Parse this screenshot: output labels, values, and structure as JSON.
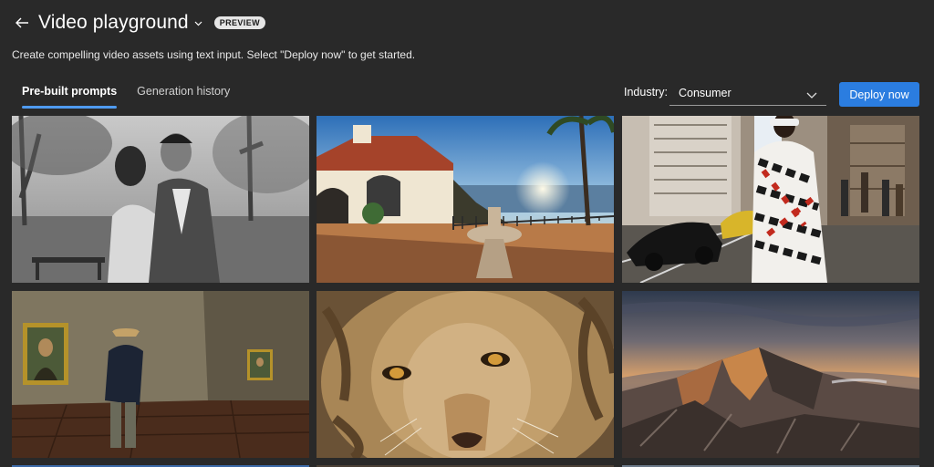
{
  "header": {
    "title": "Video playground",
    "badge": "PREVIEW"
  },
  "subtitle": "Create compelling video assets using text input. Select \"Deploy now\" to get started.",
  "tabs": [
    {
      "label": "Pre-built prompts",
      "active": true
    },
    {
      "label": "Generation history",
      "active": false
    }
  ],
  "filter": {
    "label": "Industry:",
    "selected": "Consumer"
  },
  "deploy_label": "Deploy now",
  "colors": {
    "background": "#292929",
    "accent": "#2b7de0",
    "tab_underline": "#4f9bf0"
  },
  "icons": {
    "back": "arrow-left-icon",
    "title_menu": "chevron-down-icon",
    "dropdown": "chevron-down-icon"
  }
}
